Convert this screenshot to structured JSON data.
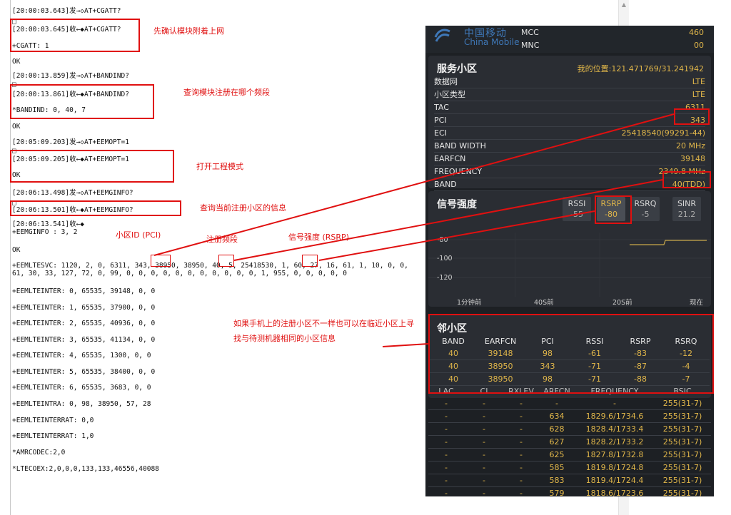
{
  "log": {
    "lines": [
      "[20:00:03.643]发→◇AT+CGATT?",
      "□",
      "[20:00:03.645]收←◆AT+CGATT?",
      "+CGATT: 1",
      "OK",
      "[20:00:13.859]发→◇AT+BANDIND?",
      "□",
      "[20:00:13.861]收←◆AT+BANDIND?",
      "*BANDIND: 0, 40, 7",
      "OK",
      "[20:05:09.203]发→◇AT+EEMOPT=1",
      "□",
      "[20:05:09.205]收←◆AT+EEMOPT=1",
      "OK",
      "[20:06:13.498]发→◇AT+EEMGINFO?",
      "□",
      "[20:06:13.501]收←◆AT+EEMGINFO?",
      "[20:06:13.541]收←◆",
      "+EEMGINFO : 3, 2",
      "OK",
      "+EEMLTESVC: 1120, 2, 0, 6311, 343, 38950, 38950, 40, 5, 25418530, 1, 60, 27, 16, 61, 1, 10, 0, 0,",
      "61, 30, 33, 127, 72, 0, 99, 0, 0, 0, 0, 0, 0, 0, 0, 0, 0, 0, 1, 955, 0, 0, 0, 0, 0",
      "+EEMLTEINTER: 0, 65535, 39148, 0, 0",
      "+EEMLTEINTER: 1, 65535, 37900, 0, 0",
      "+EEMLTEINTER: 2, 65535, 40936, 0, 0",
      "+EEMLTEINTER: 3, 65535, 41134, 0, 0",
      "+EEMLTEINTER: 4, 65535, 1300, 0, 0",
      "+EEMLTEINTER: 5, 65535, 38400, 0, 0",
      "+EEMLTEINTER: 6, 65535, 3683, 0, 0",
      "+EEMLTEINTRA: 0, 98, 38950, 57, 28",
      "+EEMLTEINTERRAT: 0,0",
      "+EEMLTEINTERRAT: 1,0",
      "*AMRCODEC:2,0",
      "*LTECOEX:2,0,0,0,133,133,46556,40088"
    ]
  },
  "annotations": {
    "attach": "先确认模块附着上网",
    "band": "查询模块注册在哪个频段",
    "eng_mode": "打开工程模式",
    "cell_info": "查询当前注册小区的信息",
    "pci_label": "小区ID (PCI)",
    "band_label": "注册频段",
    "rsrp_label": "信号强度 (RSRP)",
    "neighbor_note": "如果手机上的注册小区不一样也可以在临近小区上寻找与待测机器相同的小区信息"
  },
  "phone": {
    "logo_cn": "中国移动",
    "logo_en": "China Mobile",
    "mcc_label": "MCC",
    "mcc_value": "460",
    "mnc_label": "MNC",
    "mnc_value": "00",
    "serving": {
      "title": "服务小区",
      "location": "我的位置:121.471769/31.241942",
      "rows": [
        {
          "k": "数据网",
          "v": "LTE"
        },
        {
          "k": "小区类型",
          "v": "LTE"
        },
        {
          "k": "TAC",
          "v": "6311"
        },
        {
          "k": "PCI",
          "v": "343"
        },
        {
          "k": "ECI",
          "v": "25418540(99291-44)"
        },
        {
          "k": "BAND WIDTH",
          "v": "20 MHz"
        },
        {
          "k": "EARFCN",
          "v": "39148"
        },
        {
          "k": "FREQUENCY",
          "v": "2349.8 MHz"
        },
        {
          "k": "BAND",
          "v": "40(TDD)"
        }
      ]
    },
    "signal": {
      "title": "信号强度",
      "items": [
        {
          "label": "RSSI",
          "value": "-55"
        },
        {
          "label": "RSRP",
          "value": "-80"
        },
        {
          "label": "RSRQ",
          "value": "-5"
        },
        {
          "label": "SINR",
          "value": "21.2"
        }
      ],
      "y_ticks": [
        "-80",
        "-100",
        "-120"
      ],
      "x_ticks": [
        "1分钟前",
        "40S前",
        "20S前",
        "现在"
      ]
    },
    "neighbor": {
      "title": "邻小区",
      "headers": [
        "BAND",
        "EARFCN",
        "PCI",
        "RSSI",
        "RSRP",
        "RSRQ"
      ],
      "rows": [
        [
          "40",
          "39148",
          "98",
          "-61",
          "-83",
          "-12"
        ],
        [
          "40",
          "38950",
          "343",
          "-71",
          "-87",
          "-4"
        ],
        [
          "40",
          "38950",
          "98",
          "-71",
          "-88",
          "-7"
        ]
      ]
    },
    "gsm": {
      "headers": [
        "LAC",
        "CI",
        "RXLEV",
        "ARFCN",
        "FREQUENCY",
        "BSIC"
      ],
      "rows": [
        [
          "-",
          "-",
          "-",
          "-",
          "-",
          "255(31-7)"
        ],
        [
          "-",
          "-",
          "-",
          "634",
          "1829.6/1734.6",
          "255(31-7)"
        ],
        [
          "-",
          "-",
          "-",
          "628",
          "1828.4/1733.4",
          "255(31-7)"
        ],
        [
          "-",
          "-",
          "-",
          "627",
          "1828.2/1733.2",
          "255(31-7)"
        ],
        [
          "-",
          "-",
          "-",
          "625",
          "1827.8/1732.8",
          "255(31-7)"
        ],
        [
          "-",
          "-",
          "-",
          "585",
          "1819.8/1724.8",
          "255(31-7)"
        ],
        [
          "-",
          "-",
          "-",
          "583",
          "1819.4/1724.4",
          "255(31-7)"
        ],
        [
          "-",
          "-",
          "-",
          "579",
          "1818.6/1723.6",
          "255(31-7)"
        ]
      ]
    }
  },
  "colors": {
    "annotation_red": "#e01010",
    "value_amber": "#e0b64a",
    "phone_bg": "#1d2024"
  }
}
